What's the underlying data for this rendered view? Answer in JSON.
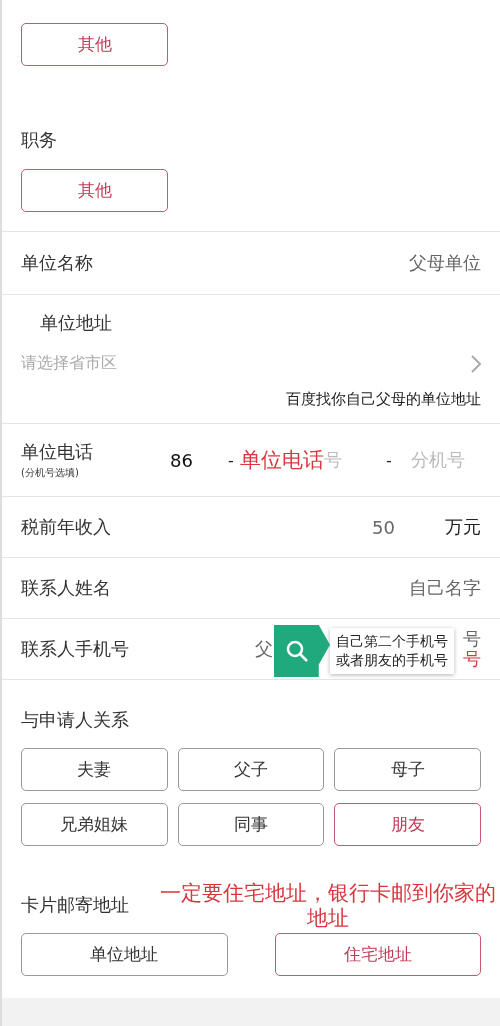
{
  "company_type": {
    "options": [
      {
        "label": "其他",
        "selected": true
      }
    ]
  },
  "position": {
    "label": "职务",
    "options": [
      {
        "label": "其他",
        "selected": true
      }
    ]
  },
  "company_name": {
    "label": "单位名称",
    "value": "父母单位"
  },
  "company_address": {
    "label": "单位地址",
    "placeholder": "请选择省市区",
    "note": "百度找你自己父母的单位地址"
  },
  "company_phone": {
    "label": "单位电话",
    "hint": "(分机号选填)",
    "area_code": "86",
    "separator_1": "-",
    "annotation": "单位电话",
    "number_placeholder": "号",
    "separator_2": "-",
    "extension_placeholder": "分机号"
  },
  "income": {
    "label": "税前年收入",
    "value": "50",
    "unit": "万元"
  },
  "contact_name": {
    "label": "联系人姓名",
    "value": "自己名字"
  },
  "contact_phone": {
    "label": "联系人手机号",
    "value_start": "父",
    "value_end": "号",
    "annotation_end": "号",
    "tooltip": {
      "lines": [
        "自己第二个手机号",
        "或者朋友的手机号"
      ]
    }
  },
  "relationship": {
    "label": "与申请人关系",
    "options": [
      {
        "label": "夫妻",
        "selected": false
      },
      {
        "label": "父子",
        "selected": false
      },
      {
        "label": "母子",
        "selected": false
      },
      {
        "label": "兄弟姐妹",
        "selected": false
      },
      {
        "label": "同事",
        "selected": false
      },
      {
        "label": "朋友",
        "selected": true
      }
    ]
  },
  "card_address": {
    "label": "卡片邮寄地址",
    "annotation": "一定要住宅地址，银行卡邮到你家的地址",
    "options": [
      {
        "label": "单位地址",
        "selected": false
      },
      {
        "label": "住宅地址",
        "selected": true
      }
    ]
  }
}
